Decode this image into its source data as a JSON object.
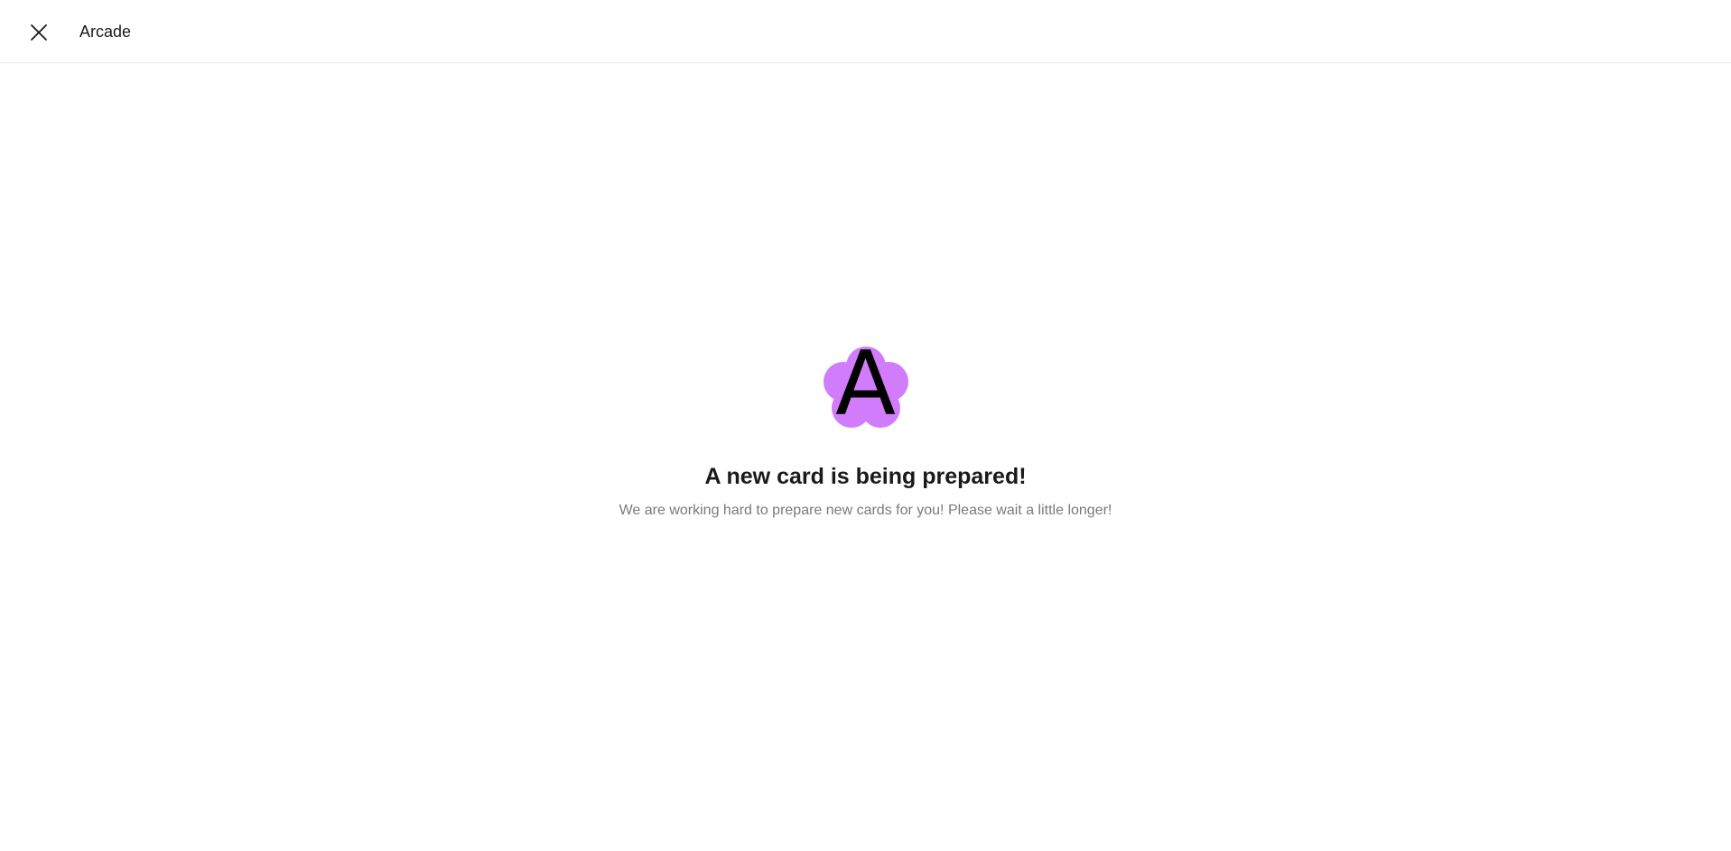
{
  "header": {
    "close_icon": "close-icon",
    "title": "Arcade"
  },
  "main": {
    "logo": {
      "letter": "A",
      "badge_color": "#d17dfb"
    },
    "headline": "A new card is being prepared!",
    "message": "We are working hard to prepare new cards for you! Please wait a little longer!"
  }
}
